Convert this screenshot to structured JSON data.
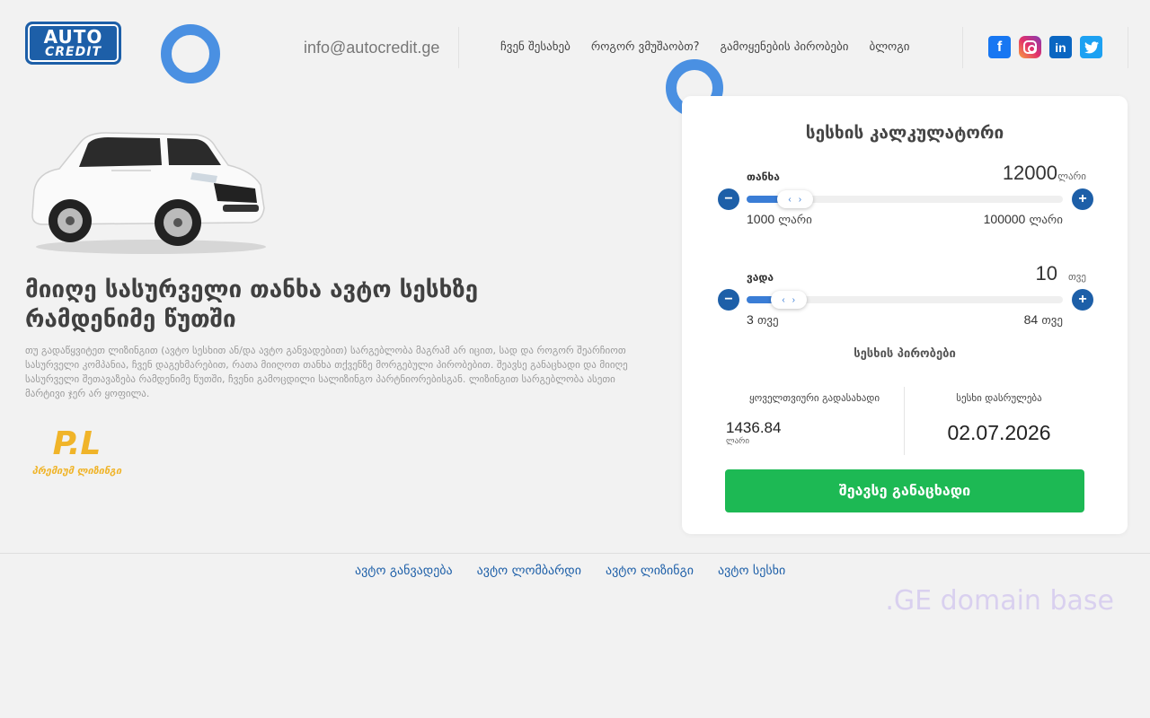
{
  "header": {
    "logo_line1": "AUTO",
    "logo_line2": "CREDIT",
    "email": "info@autocredit.ge",
    "nav": [
      "ჩვენ შესახებ",
      "როგორ ვმუშაობთ?",
      "გამოყენების პირობები",
      "ბლოგი"
    ],
    "social": [
      {
        "name": "facebook",
        "glyph": "f",
        "color": "#1877f2"
      },
      {
        "name": "instagram",
        "glyph": "",
        "color": "#e1306c"
      },
      {
        "name": "linkedin",
        "glyph": "in",
        "color": "#0a66c2"
      },
      {
        "name": "twitter",
        "glyph": "t",
        "color": "#1da1f2"
      }
    ]
  },
  "hero": {
    "title": "მიიღე სასურველი თანხა ავტო სესხზე რამდენიმე წუთში",
    "text": "თუ გადაწყვიტეთ ლიზინგით (ავტო სესხით ან/და ავტო განვადებით) სარგებლობა მაგრამ არ იცით, სად და როგორ შეარჩიოთ სასურველი კომპანია, ჩვენ დაგეხმარებით, რათა მიიღოთ თანხა თქვენზე მორგებული პირობებით. შეავსე განაცხადი და მიიღე სასურველი შეთავაზება რამდენიმე წუთში, ჩვენი გამოცდილი სალიზინგო პარტნიორებისგან. ლიზინგით სარგებლობა ასეთი მარტივი ჯერ არ ყოფილა.",
    "partner_mark": "P.L",
    "partner_caption": "პრემიუმ ლიზინგი"
  },
  "calculator": {
    "title": "სესხის კალკულატორი",
    "amount": {
      "label": "თანხა",
      "value": "12000",
      "unit": "ლარი",
      "min": "1000",
      "min_unit": "ლარი",
      "max": "100000",
      "max_unit": "ლარი",
      "fill_fraction": 0.11
    },
    "term": {
      "label": "ვადა",
      "value": "10",
      "unit": "თვე",
      "min": "3",
      "min_unit": "თვე",
      "max": "84",
      "max_unit": "თვე",
      "fill_fraction": 0.09
    },
    "handle_left": "‹",
    "handle_right": "›",
    "minus": "−",
    "plus": "+",
    "terms_link": "სესხის პირობები",
    "monthly_label": "ყოველთვიური გადასახადი",
    "monthly_value": "1436.84",
    "monthly_unit": "ლარი",
    "end_label": "სესხი დასრულება",
    "end_value": "02.07.2026",
    "apply_label": "შეავსე განაცხადი"
  },
  "footer": {
    "links": [
      "ავტო განვადება",
      "ავტო ლომბარდი",
      "ავტო ლიზინგი",
      "ავტო სესხი"
    ],
    "ge_base": ".GE domain base"
  }
}
